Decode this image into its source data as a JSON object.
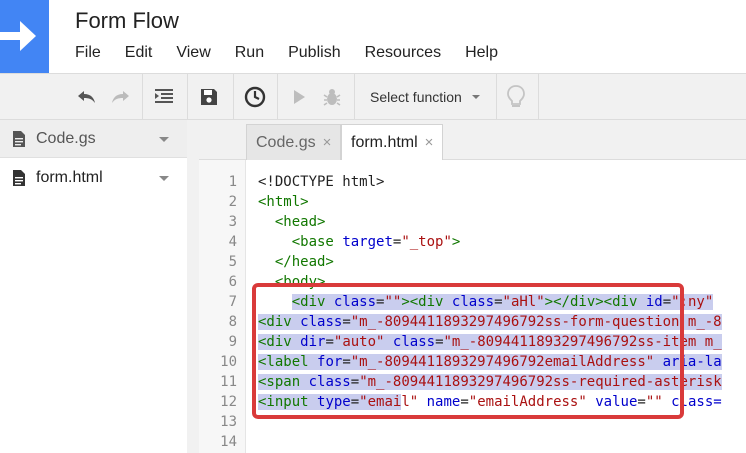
{
  "app": {
    "title": "Form Flow"
  },
  "menu": [
    "File",
    "Edit",
    "View",
    "Run",
    "Publish",
    "Resources",
    "Help"
  ],
  "toolbar": {
    "function_select": "Select function",
    "icons": [
      "undo-icon",
      "redo-icon",
      "indent-icon",
      "save-icon",
      "triggers-icon",
      "run-icon",
      "debug-icon",
      "lightbulb-icon"
    ]
  },
  "sidebar": {
    "files": [
      {
        "name": "Code.gs"
      },
      {
        "name": "form.html"
      }
    ]
  },
  "tabs": [
    {
      "label": "Code.gs",
      "close": "×"
    },
    {
      "label": "form.html",
      "close": "×"
    }
  ],
  "editor": {
    "line_numbers": [
      "1",
      "2",
      "3",
      "4",
      "5",
      "6",
      "7",
      "8",
      "9",
      "10",
      "11",
      "12",
      "13",
      "14"
    ]
  },
  "colors": {
    "brand": "#4285f4",
    "selection": "#c9cdee",
    "highlight_border": "#d93a3a",
    "tag": "#117700",
    "attr": "#0000cc",
    "string": "#aa1111"
  }
}
